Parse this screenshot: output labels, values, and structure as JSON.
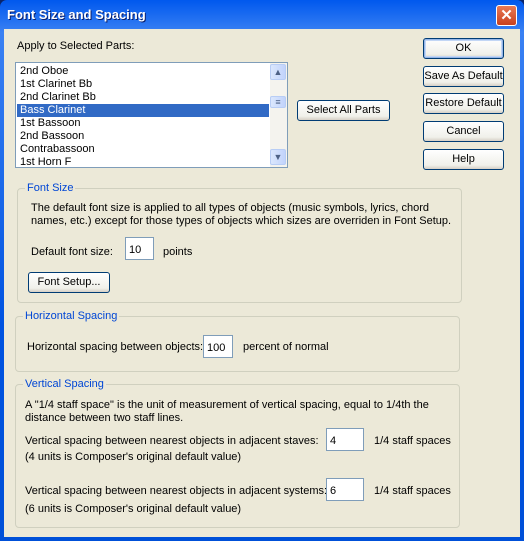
{
  "window": {
    "title": "Font Size and Spacing",
    "close_icon": "close-icon"
  },
  "parts": {
    "label": "Apply to Selected Parts:",
    "items": [
      "2nd Oboe",
      "1st Clarinet Bb",
      "2nd Clarinet Bb",
      "Bass Clarinet",
      "1st Bassoon",
      "2nd Bassoon",
      "Contrabassoon",
      "1st Horn F"
    ],
    "selected": "Bass Clarinet",
    "select_all": "Select All Parts"
  },
  "buttons": {
    "ok": "OK",
    "save_default": "Save As Default",
    "restore_default": "Restore Default",
    "cancel": "Cancel",
    "help": "Help"
  },
  "font_size": {
    "legend": "Font Size",
    "desc1": "The default font size is applied to all types of objects (music symbols, lyrics, chord",
    "desc2": "names, etc.) except for those types of objects which sizes are overriden in Font Setup.",
    "label": "Default font size:",
    "value": "10",
    "unit": "points",
    "setup": "Font Setup..."
  },
  "horizontal": {
    "legend": "Horizontal Spacing",
    "label": "Horizontal spacing between objects:",
    "value": "100",
    "unit": "percent of normal"
  },
  "vertical": {
    "legend": "Vertical Spacing",
    "desc1": "A \"1/4 staff space\" is the unit of measurement of vertical spacing, equal to 1/4th the",
    "desc2": "distance between two staff lines.",
    "staves_label": "Vertical spacing between nearest objects in adjacent staves:",
    "staves_value": "4",
    "staves_unit": "1/4 staff spaces",
    "staves_note": "(4 units is Composer's original default value)",
    "systems_label": "Vertical spacing between nearest objects in adjacent systems:",
    "systems_value": "6",
    "systems_unit": "1/4 staff spaces",
    "systems_note": "(6 units is Composer's original default value)"
  },
  "colors": {
    "accent": "#316ac5",
    "legend": "#0046d5",
    "face": "#ECE9D8"
  }
}
